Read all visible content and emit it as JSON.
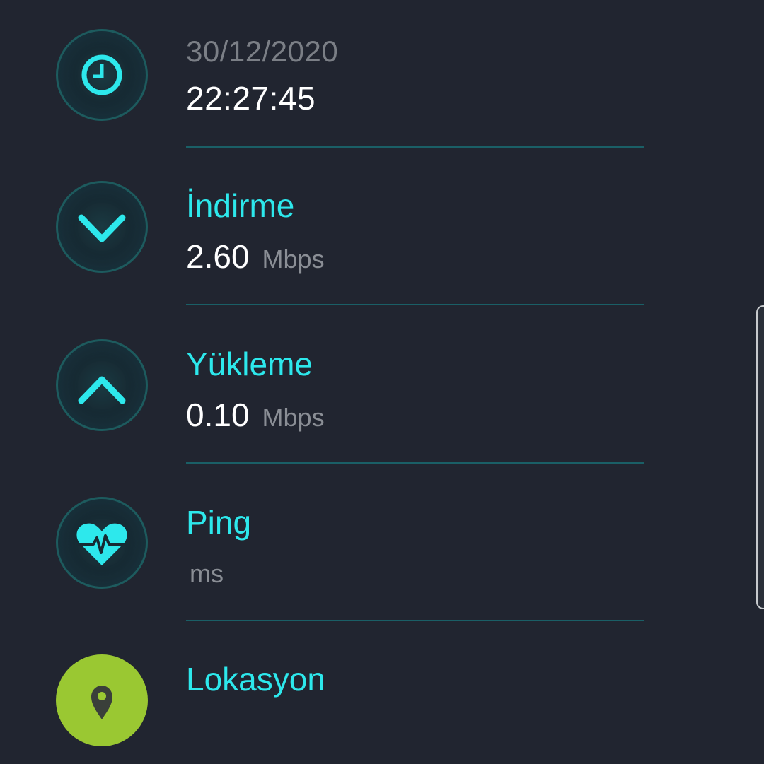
{
  "datetime": {
    "icon": "clock-icon",
    "date": "30/12/2020",
    "time": "22:27:45"
  },
  "download": {
    "icon": "chevron-down-icon",
    "label": "İndirme",
    "value": "2.60",
    "unit": "Mbps"
  },
  "upload": {
    "icon": "chevron-up-icon",
    "label": "Yükleme",
    "value": "0.10",
    "unit": "Mbps"
  },
  "ping": {
    "icon": "heartbeat-icon",
    "label": "Ping",
    "value": "",
    "unit": "ms"
  },
  "location": {
    "icon": "location-pin-icon",
    "label": "Lokasyon"
  },
  "colors": {
    "background": "#212530",
    "accent": "#2de8ec",
    "divider": "#1a5f66",
    "location_badge": "#9ac832",
    "muted_text": "#8a8e95"
  }
}
